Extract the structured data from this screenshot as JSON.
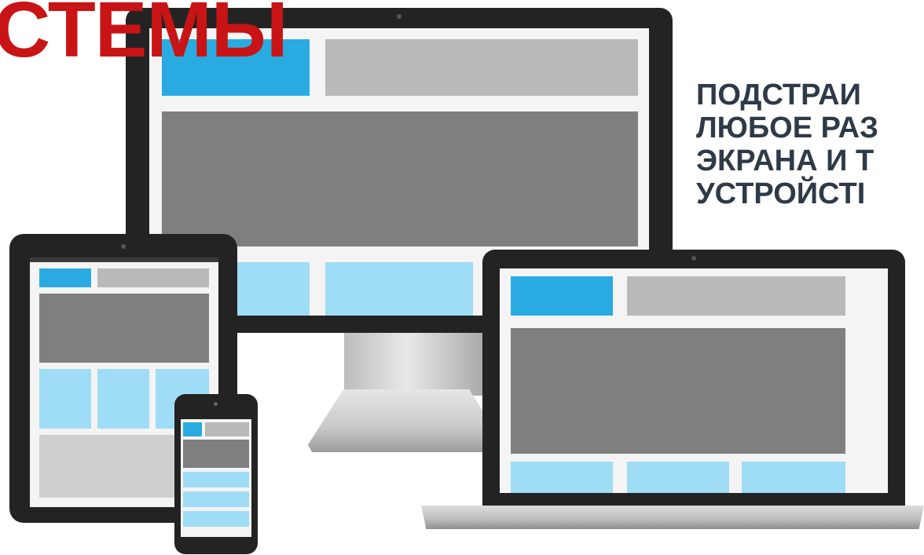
{
  "heading": {
    "text": "СТЕМЫ"
  },
  "tagline": {
    "lines": [
      "ПОДСТРАИ",
      "ЛЮБОЕ РАЗ",
      "ЭКРАНА И Т",
      "УСТРОЙСТІ"
    ]
  },
  "colors": {
    "heading": "#c81414",
    "tagline": "#2f3a48",
    "accent_blue": "#29abe2",
    "light_blue": "#9fdcf5",
    "gray_light": "#b9b9b9",
    "gray_dark": "#7f7f7f",
    "bezel": "#262626"
  },
  "devices": [
    "desktop-monitor-icon",
    "tablet-icon",
    "smartphone-icon",
    "laptop-icon"
  ]
}
